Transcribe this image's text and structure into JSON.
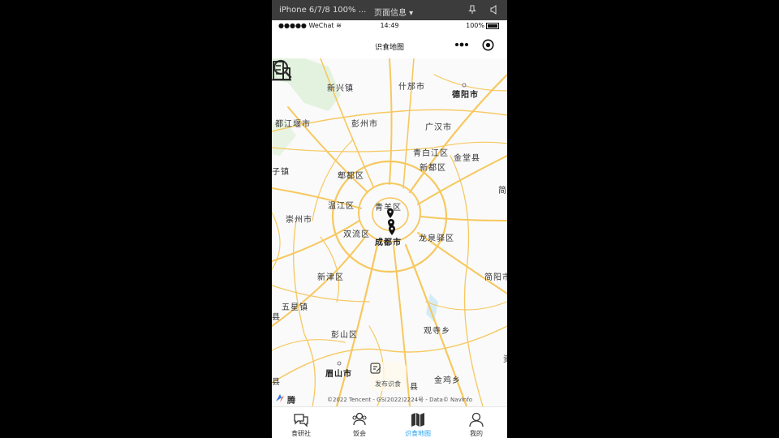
{
  "device_bar": {
    "device": "iPhone 6/7/8 100% ...",
    "page_info": "页面信息 ▾"
  },
  "status_bar": {
    "carrier": "●●●●● WeChat",
    "time": "14:49",
    "battery": "100%"
  },
  "nav_bar": {
    "title": "识食地图"
  },
  "map": {
    "labels": [
      {
        "text": "新兴镇",
        "bold": false
      },
      {
        "text": "什邡市",
        "bold": false
      },
      {
        "text": "德阳市",
        "bold": true
      },
      {
        "text": "都江堰市",
        "bold": false
      },
      {
        "text": "彭州市",
        "bold": false
      },
      {
        "text": "广汉市",
        "bold": false
      },
      {
        "text": "青白江区",
        "bold": false
      },
      {
        "text": "金堂县",
        "bold": false
      },
      {
        "text": "新都区",
        "bold": false
      },
      {
        "text": "郫都区",
        "bold": false
      },
      {
        "text": "子镇",
        "bold": false
      },
      {
        "text": "温江区",
        "bold": false
      },
      {
        "text": "青羊区",
        "bold": false
      },
      {
        "text": "崇州市",
        "bold": false
      },
      {
        "text": "双流区",
        "bold": false
      },
      {
        "text": "成都市",
        "bold": true
      },
      {
        "text": "龙泉驿区",
        "bold": false
      },
      {
        "text": "新津区",
        "bold": false
      },
      {
        "text": "简阳市",
        "bold": false
      },
      {
        "text": "五星镇",
        "bold": false
      },
      {
        "text": "彭山区",
        "bold": false
      },
      {
        "text": "观寺乡",
        "bold": false
      },
      {
        "text": "眉山市",
        "bold": true
      },
      {
        "text": "县",
        "bold": false
      },
      {
        "text": "金鸡乡",
        "bold": false
      },
      {
        "text": "县",
        "bold": false
      },
      {
        "text": "县",
        "bold": false
      },
      {
        "text": "简",
        "bold": false
      },
      {
        "text": "资",
        "bold": false
      }
    ],
    "markers": [
      {
        "name": "pin-1"
      },
      {
        "name": "pin-2"
      },
      {
        "name": "pin-3"
      }
    ],
    "publish_label": "发布识食",
    "brand": "腾讯地图",
    "copyright": "©2022 Tencent - GS(2022)2224号 - Data© NavInfo"
  },
  "tabs": [
    {
      "label": "食研社",
      "icon": "chat-icon",
      "active": false
    },
    {
      "label": "饭会",
      "icon": "group-icon",
      "active": false
    },
    {
      "label": "识食地图",
      "icon": "map-icon",
      "active": true
    },
    {
      "label": "我的",
      "icon": "user-icon",
      "active": false
    }
  ],
  "colors": {
    "accent": "#26a4f4",
    "road": "#f6c85f",
    "device_bar": "#3c3c3c"
  }
}
